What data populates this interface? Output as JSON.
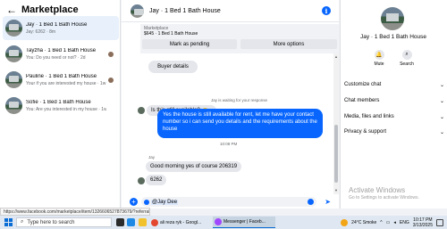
{
  "left": {
    "title": "Marketplace",
    "conversations": [
      {
        "title": "Jay · 1 Bed 1 Bath House",
        "subtitle": "Jay: 6262 · 8m"
      },
      {
        "title": "Tayzha · 1 Bed 1 Bath House",
        "subtitle": "You: Do you need or not? · 2d"
      },
      {
        "title": "Pauline · 1 Bed 1 Bath House",
        "subtitle": "Your if you are interested my house · 1w"
      },
      {
        "title": "Sofie · 1 Bed 1 Bath House",
        "subtitle": "You: Are you interested in my house · 1w"
      }
    ]
  },
  "chat": {
    "title": "Jay · 1 Bed 1 Bath House",
    "marketplace_label": "Marketplace",
    "price_line": "$645 · 1 Bed 1 Bath House",
    "mark_pending": "Mark as pending",
    "more_options": "More options",
    "buyer_details": "Buyer details",
    "still_available": "Is this still available?",
    "waiting": "Jay is waiting for your response",
    "reply": "Yes the house is still available for rent, let me have your contact number so i can send you details and the requirements about the house",
    "system_time": "10:08 PM",
    "sender": "Jay",
    "msg_morning": "Good morning yes of course 206319",
    "msg_code": "6262",
    "compose_value": "@Jay Dee"
  },
  "right": {
    "title": "Jay · 1 Bed 1 Bath House",
    "mute_label": "Mute",
    "search_label": "Search",
    "menu": [
      "Customize chat",
      "Chat members",
      "Media, files and links",
      "Privacy & support"
    ]
  },
  "watermark": {
    "line1": "Activate Windows",
    "line2": "Go to Settings to activate Windows."
  },
  "status_url": "https://www.facebook.com/marketplace/item/1326606527873679/?referralS...",
  "taskbar": {
    "search_placeholder": "Type here to search",
    "apps": [
      "ali reza ryk - Googl...",
      "Messenger | Faceb..."
    ],
    "weather": "24°C  Smoke",
    "lang": "ENG",
    "time": "10:17 PM",
    "date": "3/13/2025"
  },
  "colors": {
    "accent": "#0866ff",
    "bubble_in": "#e4e6eb",
    "active_row": "#e7f0fb"
  }
}
